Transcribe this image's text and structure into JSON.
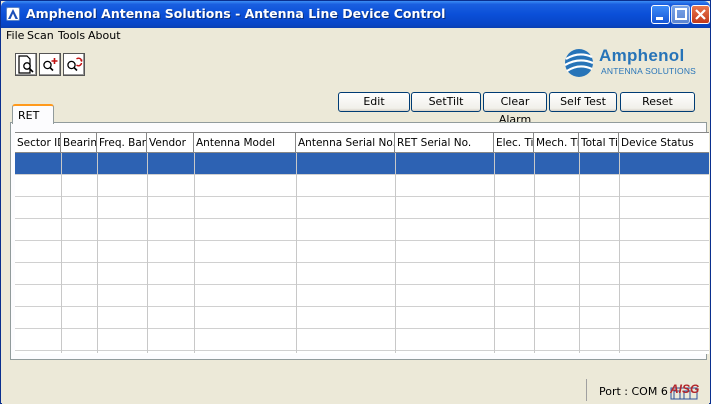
{
  "window": {
    "title": "Amphenol Antenna Solutions - Antenna Line Device Control",
    "controls": [
      "minimize-icon",
      "maximize-icon",
      "close-icon"
    ]
  },
  "menu": [
    "File",
    "Scan",
    "Tools",
    "About"
  ],
  "toolbar": {
    "icons": [
      "scan-document-icon",
      "zoom-in-icon",
      "refresh-zoom-icon"
    ]
  },
  "logo": {
    "name": "Amphenol",
    "subtitle": "ANTENNA SOLUTIONS"
  },
  "tabs": [
    {
      "label": "RET"
    }
  ],
  "actions": [
    "Edit",
    "SetTilt",
    "Clear Alarm",
    "Self Test",
    "Reset"
  ],
  "table": {
    "columns": [
      "Sector ID",
      "Bearing",
      "Freq. Band",
      "Vendor",
      "Antenna Model",
      "Antenna Serial No.",
      "RET Serial No.",
      "Elec. Tilt",
      "Mech. Tilt",
      "Total Tilt",
      "Device Status"
    ],
    "rows": [
      [],
      [],
      [],
      [],
      [],
      [],
      [],
      [],
      []
    ],
    "selected_row": 0
  },
  "status": {
    "port": "Port : COM 6",
    "badge": "AISG"
  },
  "colors": {
    "titlebar": "#0a4fd8",
    "selection": "#2d62b3",
    "tab_accent": "#ff9a1d",
    "logo": "#2774b8"
  }
}
